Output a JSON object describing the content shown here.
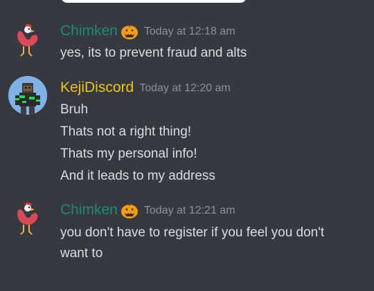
{
  "messages": [
    {
      "author": "Chimken",
      "timestamp": "Today at 12:18 am",
      "avatar_icon": "rooster-icon",
      "badge_icon": "jack-o-lantern-icon",
      "lines": [
        "yes, its to prevent fraud and alts"
      ]
    },
    {
      "author": "KejiDiscord",
      "timestamp": "Today at 12:20 am",
      "avatar_icon": "minecraft-skin-avatar",
      "lines": [
        "Bruh",
        "Thats not a right thing!",
        "Thats my personal info!",
        "And it leads to my address"
      ]
    },
    {
      "author": "Chimken",
      "timestamp": "Today at 12:21 am",
      "avatar_icon": "rooster-icon",
      "badge_icon": "jack-o-lantern-icon",
      "lines": [
        "you don't have to register if you feel you don't",
        "want to"
      ]
    }
  ],
  "colors": {
    "background": "#36393f",
    "chimken_name": "#1f8b6f",
    "keji_name": "#f1c40f",
    "timestamp": "#8e9297",
    "text": "#dcddde"
  }
}
